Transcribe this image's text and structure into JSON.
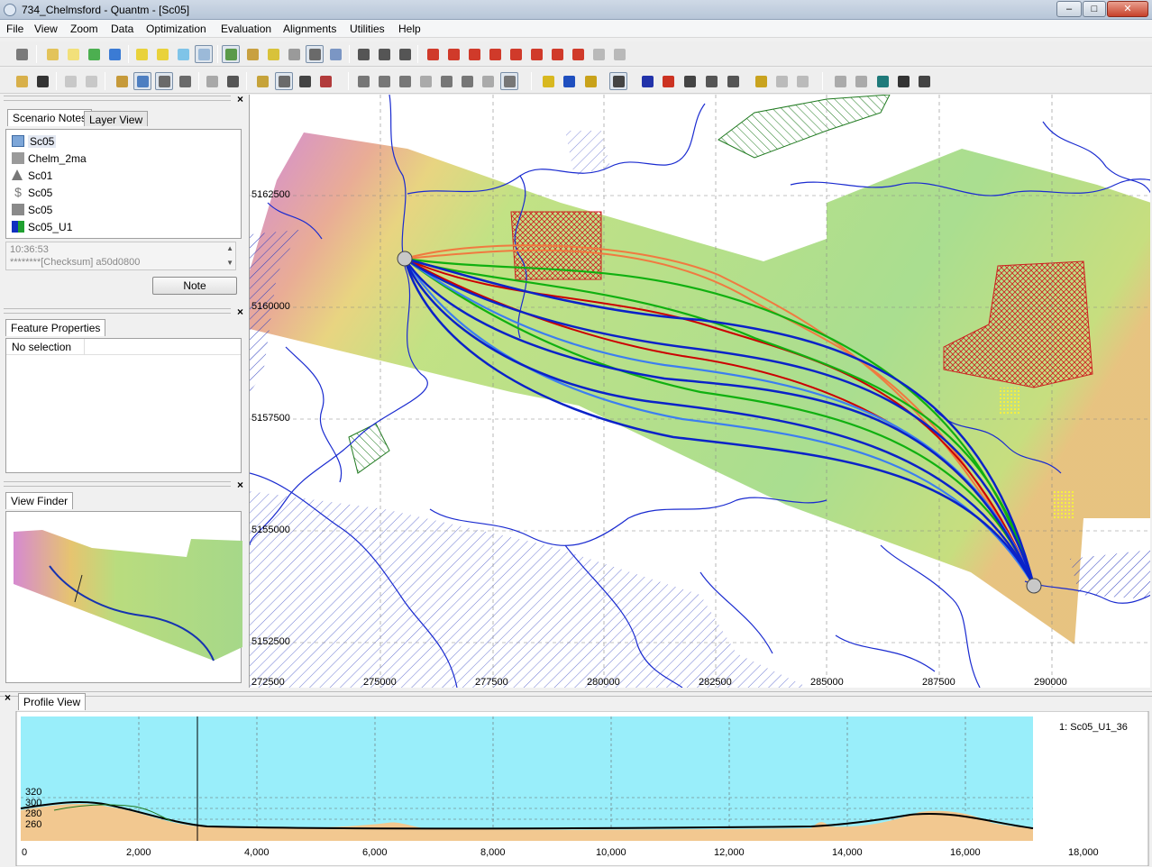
{
  "window": {
    "title": "734_Chelmsford - Quantm - [Sc05]",
    "minimize": "–",
    "maximize": "□",
    "close": "✕"
  },
  "menu": [
    "File",
    "View",
    "Zoom",
    "Data",
    "Optimization",
    "Evaluation",
    "Alignments",
    "Utilities",
    "Help"
  ],
  "scenario_notes": {
    "tab_active": "Scenario Notes",
    "tab_inactive": "Layer View",
    "items": [
      {
        "label": "Sc05",
        "icon": "folder-icon"
      },
      {
        "label": "Chelm_2ma",
        "icon": "dtm-icon"
      },
      {
        "label": "Sc01",
        "icon": "survey-icon"
      },
      {
        "label": "Sc05",
        "icon": "dollar-icon"
      },
      {
        "label": "Sc05",
        "icon": "grid-icon"
      },
      {
        "label": "Sc05_U1",
        "icon": "alignment-icon"
      }
    ],
    "note_time": "10:36:53",
    "note_text": "********[Checksum] a50d0800",
    "note_button": "Note"
  },
  "feature_properties": {
    "tab": "Feature Properties",
    "status": "No selection"
  },
  "view_finder": {
    "tab": "View Finder"
  },
  "profile_view": {
    "tab": "Profile View",
    "legend": "1: Sc05_U1_36",
    "y_ticks": [
      "320",
      "300",
      "280",
      "260"
    ],
    "x_ticks": [
      "0",
      "2,000",
      "4,000",
      "6,000",
      "8,000",
      "10,000",
      "12,000",
      "14,000",
      "16,000",
      "18,000"
    ]
  },
  "map": {
    "y_labels": [
      "5162500",
      "5160000",
      "5157500",
      "5155000",
      "5152500"
    ],
    "x_labels": [
      "272500",
      "275000",
      "277500",
      "280000",
      "282500",
      "285000",
      "287500",
      "290000"
    ]
  },
  "colors": {
    "route_blue": "#0a22c8",
    "route_light_blue": "#3c7ef0",
    "route_green": "#10b010",
    "route_red": "#cc0000",
    "route_orange": "#f07a40",
    "river": "#1a2bd0",
    "sky": "#99eefa"
  }
}
